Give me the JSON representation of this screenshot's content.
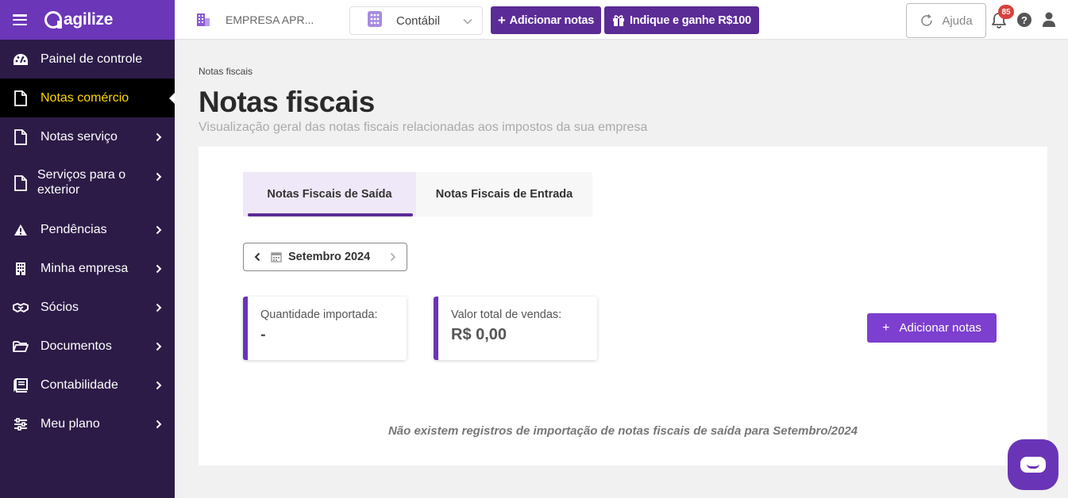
{
  "app": {
    "logo_text": "agilize"
  },
  "sidebar": {
    "items": [
      {
        "label": "Painel de controle",
        "icon": "dashboard-icon"
      },
      {
        "label": "Notas comércio",
        "icon": "document-icon"
      },
      {
        "label": "Notas serviço",
        "icon": "document-icon"
      },
      {
        "label": "Serviços para o exterior",
        "icon": "document-icon"
      },
      {
        "label": "Pendências",
        "icon": "warning-icon"
      },
      {
        "label": "Minha empresa",
        "icon": "building-icon"
      },
      {
        "label": "Sócios",
        "icon": "handshake-icon"
      },
      {
        "label": "Documentos",
        "icon": "folder-icon"
      },
      {
        "label": "Contabilidade",
        "icon": "book-icon"
      },
      {
        "label": "Meu plano",
        "icon": "sliders-icon"
      }
    ]
  },
  "topbar": {
    "company_name": "EMPRESA APR...",
    "selector_value": "Contábil",
    "add_notes_label": "Adicionar notas",
    "indique_label": "Indique e ganhe R$100",
    "help_label": "Ajuda",
    "notification_count": "85",
    "help_glyph": "?"
  },
  "page": {
    "breadcrumb": "Notas fiscais",
    "title": "Notas fiscais",
    "subtitle": "Visualização geral das notas fiscais relacionadas aos impostos da sua empresa"
  },
  "tabs": [
    {
      "label": "Notas Fiscais de Saída",
      "active": true
    },
    {
      "label": "Notas Fiscais de Entrada",
      "active": false
    }
  ],
  "month_picker": {
    "label": "Setembro 2024"
  },
  "stats": {
    "quantity": {
      "label": "Quantidade importada:",
      "value": "-"
    },
    "total": {
      "label": "Valor total de vendas:",
      "value": "R$ 0,00"
    }
  },
  "actions": {
    "add_notes_label": "Adicionar notas",
    "add_notes_plus": "+"
  },
  "empty_message": "Não existem registros de importação de notas fiscais de saída para Setembro/2024",
  "colors": {
    "sidebar_bg": "#2c1b47",
    "brand_purple": "#6b36b8",
    "button_purple": "#5b2b96",
    "active_text": "#ffd600",
    "badge_red": "#d9413d"
  }
}
